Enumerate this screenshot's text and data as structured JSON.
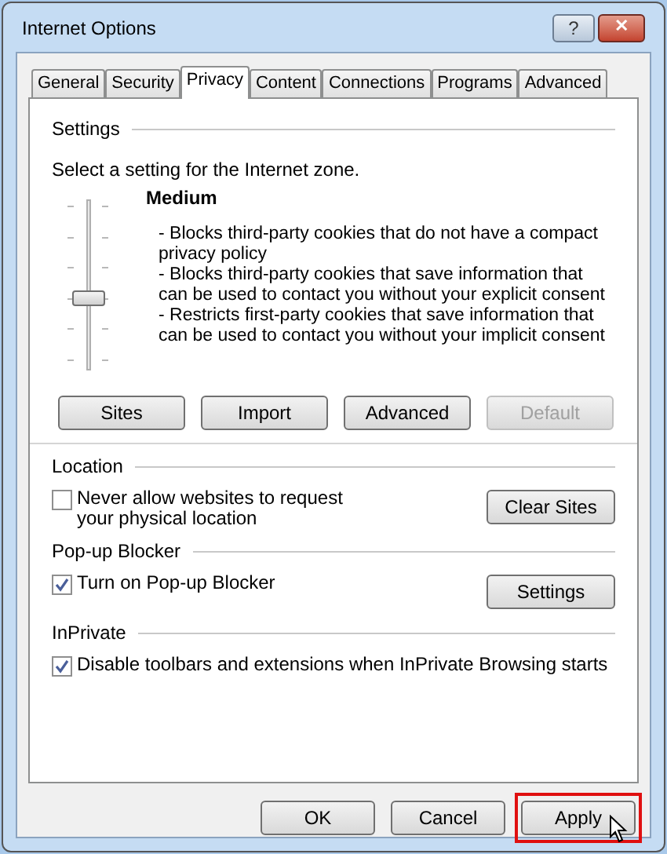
{
  "window": {
    "title": "Internet Options",
    "help": "?",
    "close": "✕"
  },
  "tabs": [
    {
      "label": "General",
      "selected": false
    },
    {
      "label": "Security",
      "selected": false
    },
    {
      "label": "Privacy",
      "selected": true
    },
    {
      "label": "Content",
      "selected": false
    },
    {
      "label": "Connections",
      "selected": false
    },
    {
      "label": "Programs",
      "selected": false
    },
    {
      "label": "Advanced",
      "selected": false
    }
  ],
  "settings": {
    "heading": "Settings",
    "prompt": "Select a setting for the Internet zone.",
    "level_name": "Medium",
    "slider": {
      "level": 0.4
    },
    "lines": [
      "- Blocks third-party cookies that do not have a compact privacy policy",
      "- Blocks third-party cookies that save information that can be used to contact you without your explicit consent",
      "- Restricts first-party cookies that save information that can be used to contact you without your implicit consent"
    ],
    "buttons": [
      {
        "label": "Sites",
        "disabled": false
      },
      {
        "label": "Import",
        "disabled": false
      },
      {
        "label": "Advanced",
        "disabled": false
      },
      {
        "label": "Default",
        "disabled": true
      }
    ]
  },
  "sections": [
    {
      "heading": "Location",
      "checkbox": {
        "label": "Never allow websites to request your physical location",
        "checked": false
      },
      "button": "Clear Sites"
    },
    {
      "heading": "Pop-up Blocker",
      "checkbox": {
        "label": "Turn on Pop-up Blocker",
        "checked": true
      },
      "button": "Settings"
    },
    {
      "heading": "InPrivate",
      "checkbox": {
        "label": "Disable toolbars and extensions when InPrivate Browsing starts",
        "checked": true
      }
    }
  ],
  "footer": [
    {
      "label": "OK",
      "highlighted": false
    },
    {
      "label": "Cancel",
      "highlighted": false
    },
    {
      "label": "Apply",
      "highlighted": true
    }
  ]
}
